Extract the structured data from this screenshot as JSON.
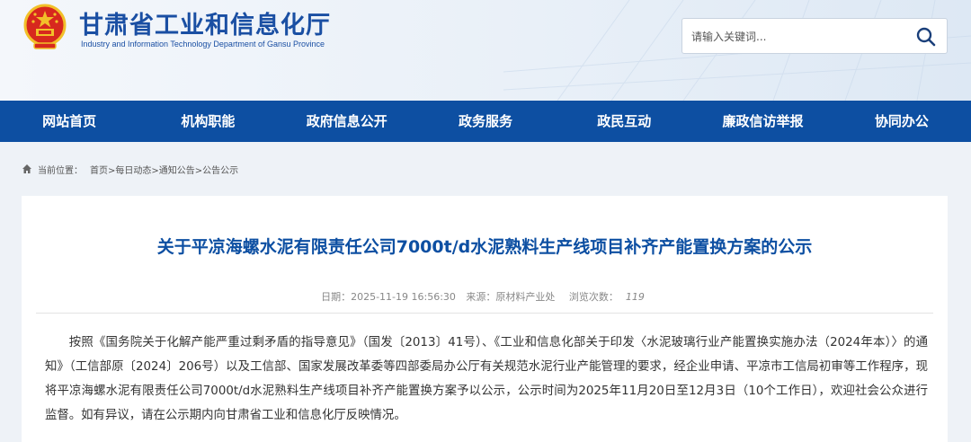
{
  "header": {
    "title": "甘肃省工业和信息化厅",
    "subtitle": "Industry and Information Technology Department of Gansu Province",
    "emblem_icon": "national-emblem-icon"
  },
  "search": {
    "placeholder": "请输入关键词...",
    "icon": "search-icon"
  },
  "nav": {
    "items": [
      {
        "label": "网站首页"
      },
      {
        "label": "机构职能"
      },
      {
        "label": "政府信息公开"
      },
      {
        "label": "政务服务"
      },
      {
        "label": "政民互动"
      },
      {
        "label": "廉政信访举报"
      },
      {
        "label": "协同办公"
      }
    ]
  },
  "breadcrumb": {
    "label": "当前位置：",
    "path": "首页>每日动态>通知公告>公告公示"
  },
  "article": {
    "title": "关于平凉海螺水泥有限责任公司7000t/d水泥熟料生产线项目补齐产能置换方案的公示",
    "date_label": "日期：2025-11-19 16:56:30",
    "source_label": "来源：原材料产业处",
    "views_label": "浏览次数：",
    "views_count": "119",
    "body": "按照《国务院关于化解产能严重过剩矛盾的指导意见》（国发〔2013〕41号）、《工业和信息化部关于印发〈水泥玻璃行业产能置换实施办法（2024年本）〉的通知》（工信部原〔2024〕206号）以及工信部、国家发展改革委等四部委局办公厅有关规范水泥行业产能管理的要求，经企业申请、平凉市工信局初审等工作程序，现将平凉海螺水泥有限责任公司7000t/d水泥熟料生产线项目补齐产能置换方案予以公示，公示时间为2025年11月20日至12月3日（10个工作日），欢迎社会公众进行监督。如有异议，请在公示期内向甘肃省工业和信息化厅反映情况。"
  },
  "colors": {
    "brand_blue": "#0d4fa2",
    "title_blue": "#1a4fa3",
    "emblem_red": "#d7281e",
    "emblem_gold": "#f2c029"
  }
}
